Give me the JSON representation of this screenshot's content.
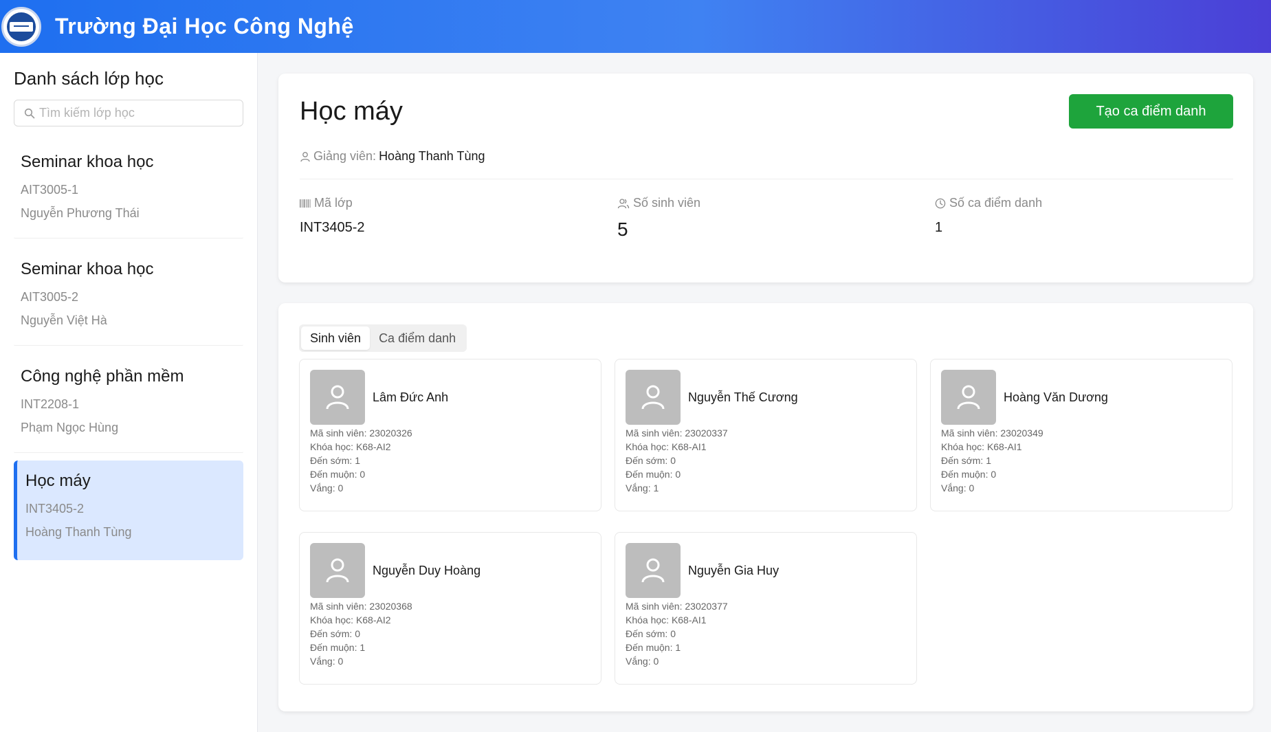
{
  "header": {
    "title": "Trường Đại Học Công Nghệ"
  },
  "sidebar": {
    "heading": "Danh sách lớp học",
    "search_placeholder": "Tìm kiếm lớp học",
    "classes": [
      {
        "title": "Seminar khoa học",
        "code": "AIT3005-1",
        "teacher": "Nguyễn Phương Thái"
      },
      {
        "title": "Seminar khoa học",
        "code": "AIT3005-2",
        "teacher": "Nguyễn Việt Hà"
      },
      {
        "title": "Công nghệ phần mềm",
        "code": "INT2208-1",
        "teacher": "Phạm Ngọc Hùng"
      },
      {
        "title": "Học máy",
        "code": "INT3405-2",
        "teacher": "Hoàng Thanh Tùng"
      }
    ]
  },
  "detail": {
    "class_name": "Học máy",
    "create_button": "Tạo ca điểm danh",
    "teacher_label": "Giảng viên:",
    "teacher_name": "Hoàng Thanh Tùng",
    "stats": {
      "code_label": "Mã lớp",
      "code_value": "INT3405-2",
      "students_label": "Số sinh viên",
      "students_value": "5",
      "sessions_label": "Số ca điểm danh",
      "sessions_value": "1"
    }
  },
  "tabs": {
    "students": "Sinh viên",
    "sessions": "Ca điểm danh"
  },
  "students": [
    {
      "name": "Lâm Đức Anh",
      "id": "Mã sinh viên: 23020326",
      "course": "Khóa học: K68-AI2",
      "early": "Đến sớm: 1",
      "late": "Đến muộn: 0",
      "absent": "Vắng: 0"
    },
    {
      "name": "Nguyễn Thế Cương",
      "id": "Mã sinh viên: 23020337",
      "course": "Khóa học: K68-AI1",
      "early": "Đến sớm: 0",
      "late": "Đến muộn: 0",
      "absent": "Vắng: 1"
    },
    {
      "name": "Hoàng Văn Dương",
      "id": "Mã sinh viên: 23020349",
      "course": "Khóa học: K68-AI1",
      "early": "Đến sớm: 1",
      "late": "Đến muộn: 0",
      "absent": "Vắng: 0"
    },
    {
      "name": "Nguyễn Duy Hoàng",
      "id": "Mã sinh viên: 23020368",
      "course": "Khóa học: K68-AI2",
      "early": "Đến sớm: 0",
      "late": "Đến muộn: 1",
      "absent": "Vắng: 0"
    },
    {
      "name": "Nguyễn Gia Huy",
      "id": "Mã sinh viên: 23020377",
      "course": "Khóa học: K68-AI1",
      "early": "Đến sớm: 0",
      "late": "Đến muộn: 1",
      "absent": "Vắng: 0"
    }
  ]
}
